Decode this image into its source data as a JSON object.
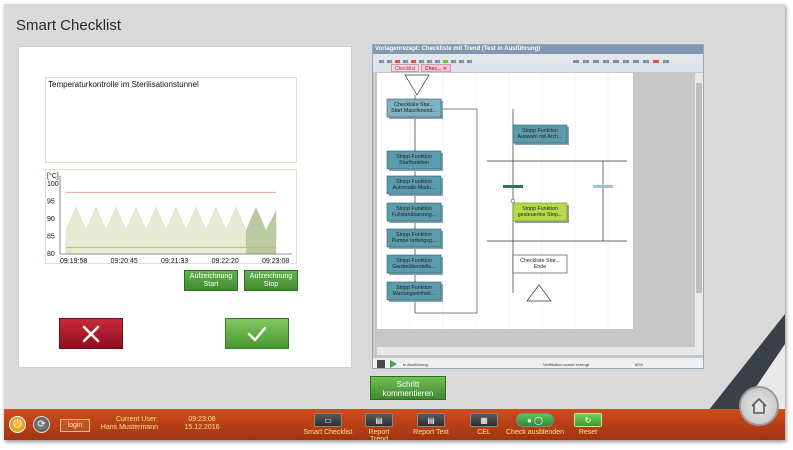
{
  "app": {
    "title": "Smart Checklist"
  },
  "description": "Temperaturkontrolle im Sterilisationstunnel",
  "chart_data": {
    "type": "area",
    "ylabel": "[°C]",
    "yticks": [
      "100",
      "95",
      "90",
      "85",
      "80"
    ],
    "ylim": [
      80,
      101
    ],
    "xticks": [
      "09:19:58",
      "09:20:45",
      "09:21:33",
      "09:22:20",
      "09:23:08"
    ],
    "limit_upper": 98.5,
    "limit_lower": 82,
    "values": [
      87,
      94,
      87,
      94,
      87,
      94,
      87,
      94,
      87,
      94,
      87,
      94,
      87,
      94,
      87,
      94,
      87,
      94,
      87,
      94,
      87,
      93
    ],
    "highlight_from_index": 18,
    "colors": {
      "area": "#e6ead2",
      "highlight": "#b9c9a0",
      "upper_limit": "#f4a0a0",
      "lower_limit": "#c8b27a"
    }
  },
  "recording": {
    "start": [
      "Aufzeichnung",
      "Start"
    ],
    "stop": [
      "Aufzeichnung",
      "Stop"
    ]
  },
  "workflow": {
    "window_title": "Vorlagenrezept: Checkliste mit Trend (Test in Ausführung)",
    "tabs": [
      "Checklist",
      "Chec..."
    ],
    "status_text": "In Ausführung",
    "status_info": "Verifikation wurde erzeugt",
    "zoom": "60%",
    "nodes_left": [
      [
        "Checkliste Star...",
        "Start Maschinend..."
      ],
      [
        "Stopp Funktion",
        "Startfunktion"
      ],
      [
        "Stopp Funktion",
        "Automatik-Modu..."
      ],
      [
        "Stopp Funktion",
        "Fullstandsanzeig..."
      ],
      [
        "Stopp Funktion",
        "Pumpe ordungsg..."
      ],
      [
        "Stopp Funktion",
        "Geräteüberstellu..."
      ],
      [
        "Stopp Funktion",
        "Wartungseinheit..."
      ]
    ],
    "node_right_top": [
      "Stopp Funktion",
      "Auswahl mit Arch..."
    ],
    "node_right_active": [
      "Stopp Funktion",
      "gesteuertes Stop..."
    ],
    "node_end": [
      "Checkliste Star...",
      "Ende"
    ]
  },
  "comment_button": [
    "Schritt",
    "kommentieren"
  ],
  "bottombar": {
    "login": "login",
    "user_label": [
      "Current User:",
      "Hans Mustermann"
    ],
    "time": "09:23:08",
    "date": "15.12.2016",
    "items": [
      {
        "label": "Smart Checklist"
      },
      {
        "label": "Report Trend"
      },
      {
        "label": "Report Text"
      },
      {
        "label": "CEL"
      },
      {
        "label": "Check ausblenden"
      },
      {
        "label": "Reset"
      }
    ]
  }
}
